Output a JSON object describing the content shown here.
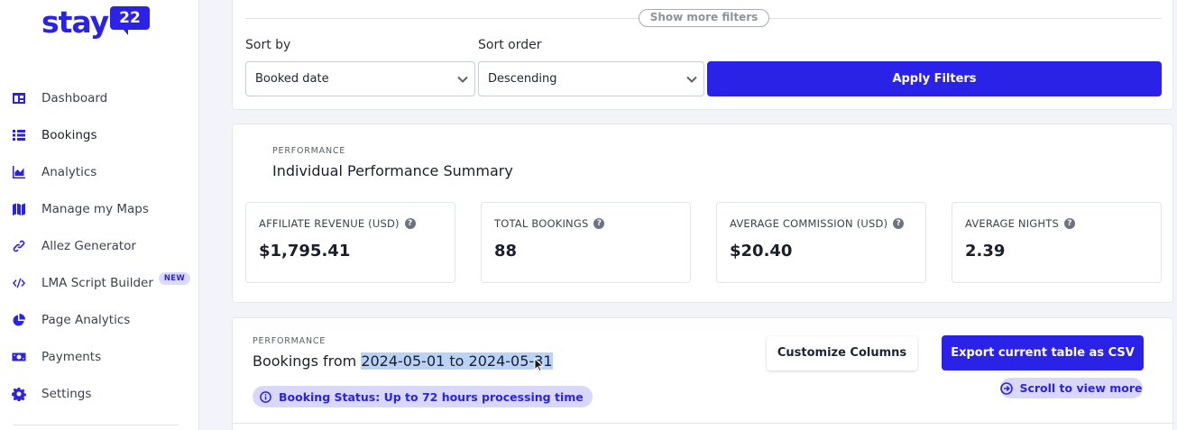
{
  "brand": {
    "word": "stay",
    "badge": "22",
    "color": "#2b22e8"
  },
  "sidebar": {
    "items": [
      {
        "label": "Dashboard",
        "icon": "dashboard-icon"
      },
      {
        "label": "Bookings",
        "icon": "list-icon",
        "active": true
      },
      {
        "label": "Analytics",
        "icon": "chart-area-icon"
      },
      {
        "label": "Manage my Maps",
        "icon": "map-icon"
      },
      {
        "label": "Allez Generator",
        "icon": "link-icon"
      },
      {
        "label": "LMA Script Builder",
        "icon": "code-icon",
        "badge": "NEW"
      },
      {
        "label": "Page Analytics",
        "icon": "pie-chart-icon"
      },
      {
        "label": "Payments",
        "icon": "money-icon"
      },
      {
        "label": "Settings",
        "icon": "gear-icon"
      }
    ]
  },
  "filters": {
    "show_more": "Show more filters",
    "sort_by_label": "Sort by",
    "sort_by_value": "Booked date",
    "sort_order_label": "Sort order",
    "sort_order_value": "Descending",
    "apply_label": "Apply Filters"
  },
  "summary": {
    "eyebrow": "PERFORMANCE",
    "title": "Individual Performance Summary",
    "stats": [
      {
        "label": "AFFILIATE REVENUE (USD)",
        "value": "$1,795.41"
      },
      {
        "label": "TOTAL BOOKINGS",
        "value": "88"
      },
      {
        "label": "AVERAGE COMMISSION (USD)",
        "value": "$20.40"
      },
      {
        "label": "AVERAGE NIGHTS",
        "value": "2.39"
      }
    ]
  },
  "bookings": {
    "eyebrow": "PERFORMANCE",
    "title_prefix": "Bookings from ",
    "date_range": "2024-05-01 to 2024-05-31",
    "status_text": "Booking Status: Up to 72 hours processing time",
    "customize_label": "Customize Columns",
    "export_label": "Export current table as CSV",
    "scroll_label": "Scroll to view more"
  }
}
